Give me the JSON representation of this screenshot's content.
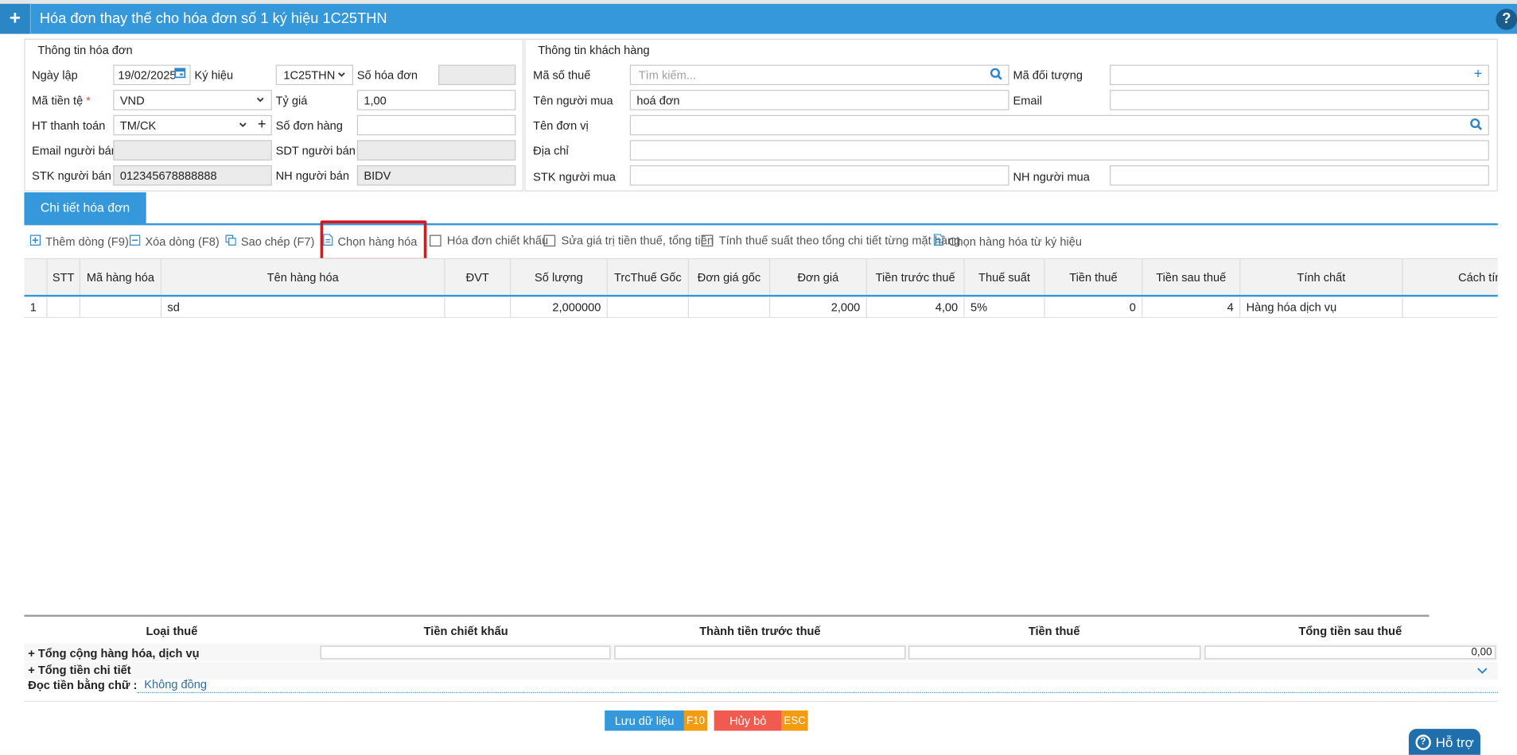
{
  "window": {
    "title": "Hóa đơn thay thế cho hóa đơn số 1 ký hiệu 1C25THN",
    "plus_glyph": "+",
    "help_glyph": "?"
  },
  "invoice_info": {
    "title": "Thông tin hóa đơn",
    "ngay_lap": {
      "label": "Ngày lập",
      "value": "19/02/2025"
    },
    "ky_hieu": {
      "label": "Ký hiệu",
      "value": "1C25THN"
    },
    "so_hoa_don": {
      "label": "Số hóa đơn",
      "value": ""
    },
    "ma_tien_te": {
      "label": "Mã tiền tệ",
      "required_mark": "*",
      "value": "VND"
    },
    "ty_gia": {
      "label": "Tỷ giá",
      "value": "1,00"
    },
    "ht_thanh_toan": {
      "label": "HT thanh toán",
      "value": "TM/CK"
    },
    "so_don_hang": {
      "label": "Số đơn hàng",
      "value": ""
    },
    "email_nguoi_ban": {
      "label": "Email người bán",
      "value": ""
    },
    "sdt_nguoi_ban": {
      "label": "SDT người bán",
      "value": ""
    },
    "stk_nguoi_ban": {
      "label": "STK người bán",
      "value": "012345678888888"
    },
    "nh_nguoi_ban": {
      "label": "NH người bán",
      "value": "BIDV"
    }
  },
  "customer_info": {
    "title": "Thông tin khách hàng",
    "ma_so_thue": {
      "label": "Mã số thuế",
      "placeholder": "Tìm kiếm..."
    },
    "ma_doi_tuong": {
      "label": "Mã đối tượng",
      "value": ""
    },
    "ten_nguoi_mua": {
      "label": "Tên người mua",
      "value": "hoá đơn"
    },
    "email": {
      "label": "Email",
      "value": ""
    },
    "ten_don_vi": {
      "label": "Tên đơn vị",
      "value": ""
    },
    "dia_chi": {
      "label": "Địa chỉ",
      "value": ""
    },
    "stk_nguoi_mua": {
      "label": "STK người mua",
      "value": ""
    },
    "nh_nguoi_mua": {
      "label": "NH người mua",
      "value": ""
    }
  },
  "tab": {
    "label": "Chi tiết hóa đơn"
  },
  "toolbar": {
    "them_dong": "Thêm dòng (F9)",
    "xoa_dong": "Xóa dòng (F8)",
    "sao_chep": "Sao chép (F7)",
    "chon_hang_hoa": "Chọn hàng hóa",
    "hoa_don_chiet_khau": "Hóa đơn chiết khấu",
    "sua_gia_tri": "Sửa giá trị tiền thuế, tổng tiền",
    "tinh_thue_suat": "Tính thuế suất theo tổng chi tiết từng mặt hàng",
    "chon_hang_hoa_ky_hieu": "Chọn hàng hóa từ ký hiệu"
  },
  "grid": {
    "headers": [
      "",
      "STT",
      "Mã hàng hóa",
      "Tên hàng hóa",
      "ĐVT",
      "Số lượng",
      "TrcThuế Gốc",
      "Đơn giá gốc",
      "Đơn giá",
      "Tiền trước thuế",
      "Thuế suất",
      "Tiền thuế",
      "Tiền sau thuế",
      "Tính chất",
      "Cách tín"
    ],
    "rows": [
      [
        "1",
        "",
        "",
        "sd",
        "",
        "2,000000",
        "",
        "",
        "2,000",
        "4,00",
        "5%",
        "0",
        "4",
        "Hàng hóa dịch vụ",
        ""
      ]
    ]
  },
  "summary": {
    "headers": {
      "loai_thue": "Loại thuế",
      "tien_chiet_khau": "Tiền chiết khấu",
      "thanh_tien_truoc_thue": "Thành tiền trước thuế",
      "tien_thue": "Tiền thuế",
      "tong_tien_sau_thue": "Tổng tiền sau thuế"
    },
    "tong_cong": "+ Tổng cộng hàng hóa, dịch vụ",
    "tong_tien_chi_tiet": "+ Tổng tiền chi tiết",
    "tong_sau_thue_value": "0,00",
    "doc_tien_label": "Đọc tiền bằng chữ :",
    "doc_tien_value": "Không đồng"
  },
  "footer": {
    "save_label": "Lưu dữ liệu",
    "save_key": "F10",
    "cancel_label": "Hủy bỏ",
    "cancel_key": "ESC",
    "help_label": "Hỗ trợ"
  },
  "colors": {
    "primary": "#3498db",
    "highlight": "#e0151a",
    "save": "#3498db",
    "cancel": "#f05a4f",
    "key_badge": "#f39c12"
  }
}
